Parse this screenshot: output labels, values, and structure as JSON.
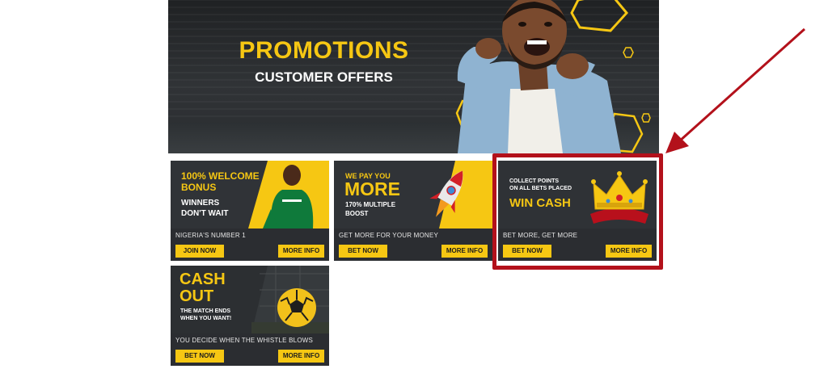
{
  "hero": {
    "title": "PROMOTIONS",
    "subtitle": "CUSTOMER OFFERS"
  },
  "cards": [
    {
      "headline_1": "100% WELCOME",
      "headline_2": "BONUS",
      "sub_1": "WINNERS",
      "sub_2": "DON'T WAIT",
      "tagline": "NIGERIA'S NUMBER 1",
      "primary_label": "JOIN NOW",
      "info_label": "MORE INFO"
    },
    {
      "small_1": "WE PAY YOU",
      "big": "MORE",
      "sub_1": "170% MULTIPLE",
      "sub_2": "BOOST",
      "tagline": "GET MORE FOR YOUR MONEY",
      "primary_label": "BET NOW",
      "info_label": "MORE INFO"
    },
    {
      "small_1": "COLLECT POINTS",
      "small_2": "ON ALL BETS PLACED",
      "big": "WIN CASH",
      "tagline": "BET MORE, GET MORE",
      "primary_label": "BET NOW",
      "info_label": "MORE INFO"
    },
    {
      "big_1": "CASH",
      "big_2": "OUT",
      "sub_1": "THE MATCH ENDS",
      "sub_2": "WHEN YOU WANT!",
      "tagline": "YOU DECIDE WHEN THE WHISTLE BLOWS",
      "primary_label": "BET NOW",
      "info_label": "MORE INFO"
    }
  ],
  "colors": {
    "accent": "#f6c713",
    "card_bg": "#2b2d31",
    "highlight": "#b3111b"
  },
  "icons": [
    "hexagon-outline-icon",
    "rocket-icon",
    "crown-icon",
    "football-icon"
  ]
}
